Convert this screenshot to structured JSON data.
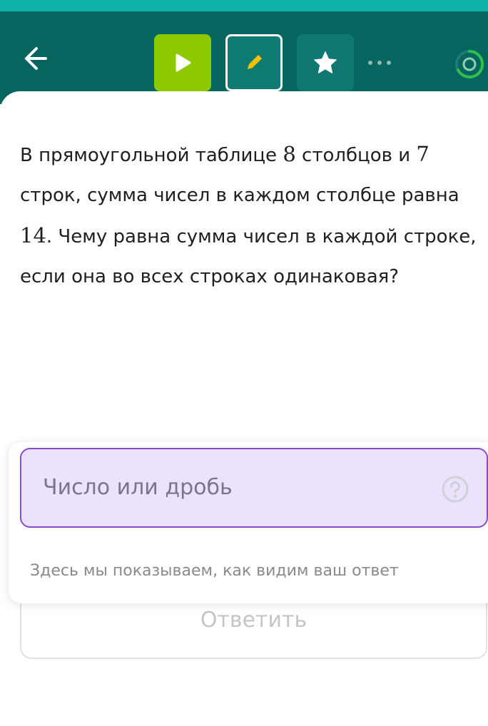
{
  "colors": {
    "top_strip": "#0fb3a9",
    "toolbar": "#07655f",
    "play_button": "#8cc900",
    "pencil": "#f2c200",
    "input_border": "#8a4fc7",
    "input_fill": "#ebe3fd",
    "progress_ring": "#2fbf4a"
  },
  "toolbar": {
    "back_icon": "arrow-left-icon",
    "play_icon": "play-icon",
    "edit_icon": "pencil-icon",
    "star_icon": "star-icon",
    "more_icon": "more-dots-icon",
    "progress_icon": "progress-ring-icon"
  },
  "problem": {
    "text_1": "В прямоугольной таблице ",
    "num_columns": "8",
    "text_2": " столбцов и ",
    "num_rows": "7",
    "text_3": " строк, сумма чисел в каждом столбце равна ",
    "column_sum": "14",
    "text_4": ". Чему равна сумма чисел в каждой строке, если она во всех строках одинаковая?"
  },
  "answer": {
    "placeholder": "Число или дробь",
    "help_icon": "question-circle-icon",
    "hint": "Здесь мы показываем, как видим ваш ответ",
    "submit_label": "Ответить"
  }
}
